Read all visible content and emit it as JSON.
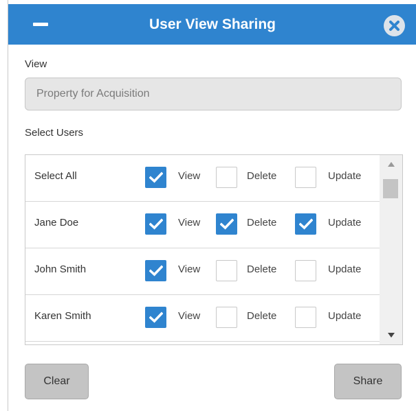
{
  "dialog": {
    "title": "User View Sharing",
    "colors": {
      "titlebar": "#2f84cf",
      "checkbox_checked": "#2f84cf"
    },
    "icons": {
      "minimize": "minimize-icon",
      "close": "close-circle-icon",
      "check": "checkmark-icon"
    }
  },
  "view": {
    "label": "View",
    "value": "Property for Acquisition"
  },
  "users": {
    "label": "Select Users",
    "permission_labels": {
      "view": "View",
      "delete": "Delete",
      "update": "Update"
    },
    "rows": [
      {
        "name": "Select All",
        "view": true,
        "delete": false,
        "update": false
      },
      {
        "name": "Jane Doe",
        "view": true,
        "delete": true,
        "update": true
      },
      {
        "name": "John Smith",
        "view": true,
        "delete": false,
        "update": false
      },
      {
        "name": "Karen Smith",
        "view": true,
        "delete": false,
        "update": false
      }
    ]
  },
  "footer": {
    "clear_label": "Clear",
    "share_label": "Share"
  }
}
